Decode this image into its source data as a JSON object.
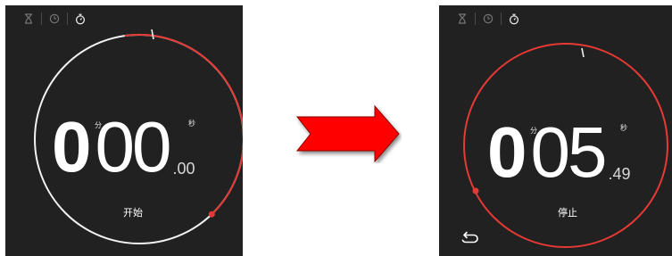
{
  "colors": {
    "panel_background": "#212121",
    "ring_white": "#f2f2f2",
    "ring_red": "#e53935",
    "arrow_red": "#ff0000"
  },
  "tabs": [
    {
      "icon": "hourglass-icon"
    },
    {
      "icon": "clock-icon"
    },
    {
      "icon": "stopwatch-icon",
      "active": true
    }
  ],
  "before": {
    "minutes": "0",
    "minute_unit": "分",
    "seconds": "00",
    "second_unit": "秒",
    "hundredths": ".00",
    "action_label": "开始",
    "progress_red_fraction": 0.4
  },
  "after": {
    "minutes": "0",
    "minute_unit": "分",
    "seconds": "05",
    "second_unit": "秒",
    "hundredths": ".49",
    "action_label": "停止",
    "reset_icon": "reset-icon"
  },
  "transition_icon": "right-arrow-icon"
}
